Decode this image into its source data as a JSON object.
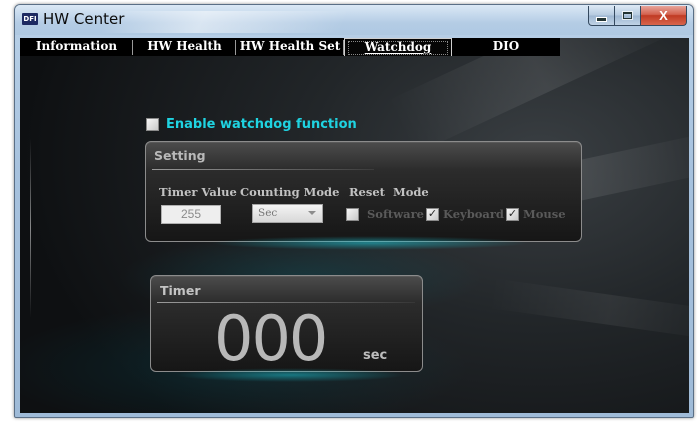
{
  "window": {
    "logo_text": "DFI",
    "title": "HW Center",
    "controls": {
      "minimize": "minimize",
      "maximize": "maximize",
      "close": "X"
    }
  },
  "tabs": [
    {
      "label": "Information",
      "active": false
    },
    {
      "label": "HW Health",
      "active": false
    },
    {
      "label": "HW Health Set",
      "active": false
    },
    {
      "label": "Watchdog",
      "active": true
    },
    {
      "label": "DIO",
      "active": false
    }
  ],
  "watchdog": {
    "enable_label": "Enable watchdog function",
    "enable_checked": false,
    "setting": {
      "title": "Setting",
      "timer_value_header": "Timer Value",
      "counting_mode_header": "Counting Mode",
      "reset_mode_header": "Reset  Mode",
      "timer_value": "255",
      "counting_mode": "Sec",
      "reset_options": [
        {
          "label": "Software",
          "checked": false
        },
        {
          "label": "Keyboard",
          "checked": true
        },
        {
          "label": "Mouse",
          "checked": true
        }
      ]
    },
    "timer": {
      "title": "Timer",
      "value": "000",
      "unit": "sec"
    }
  },
  "colors": {
    "accent": "#1fd3e1",
    "background": "#16191b",
    "text_dim": "#5a5a5a"
  }
}
